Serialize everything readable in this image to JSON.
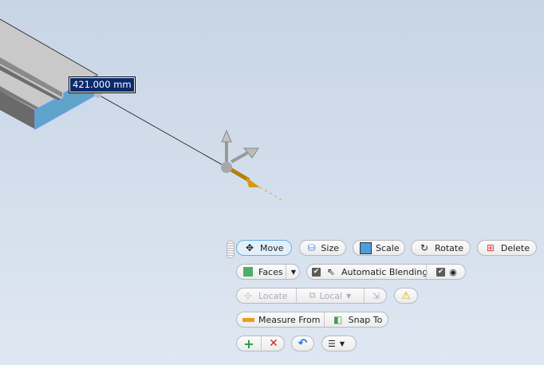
{
  "viewport": {
    "dimension_value": "421.000 mm"
  },
  "toolbar": {
    "row1": {
      "move": "Move",
      "size": "Size",
      "scale": "Scale",
      "rotate": "Rotate",
      "delete": "Delete"
    },
    "row2": {
      "faces": "Faces",
      "automatic_blending": "Automatic Blending",
      "blending_checked": true,
      "visibility_checked": true
    },
    "row3": {
      "locate": "Locate",
      "local": "Local"
    },
    "row4": {
      "measure_from": "Measure From",
      "snap_to": "Snap To"
    }
  },
  "colors": {
    "accent": "#6aaee0",
    "face_highlight": "#5fa3c8",
    "gizmo_active": "#d99a12"
  }
}
